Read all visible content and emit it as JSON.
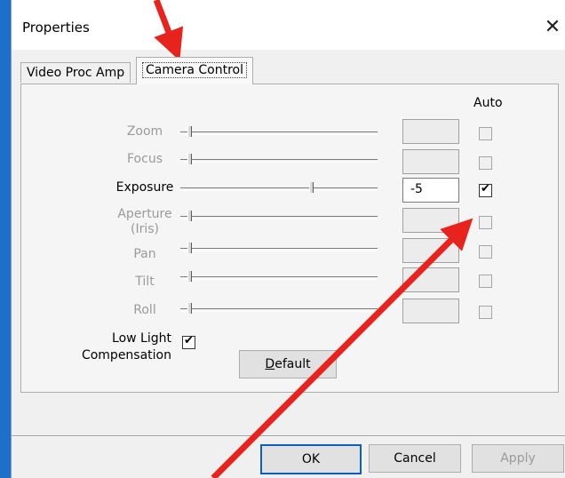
{
  "window": {
    "title": "Properties",
    "close_glyph": "✕"
  },
  "tabs": [
    {
      "label": "Video Proc Amp"
    },
    {
      "label": "Camera Control"
    }
  ],
  "auto_header": "Auto",
  "controls": [
    {
      "label": "Zoom",
      "value": "",
      "enabled": false,
      "slider_level": 0,
      "auto": false
    },
    {
      "label": "Focus",
      "value": "",
      "enabled": false,
      "slider_level": 0,
      "auto": false
    },
    {
      "label": "Exposure",
      "value": "-5",
      "enabled": true,
      "slider_level": 0.68,
      "auto": true
    },
    {
      "label": "Aperture",
      "sublabel": "(Iris)",
      "value": "",
      "enabled": false,
      "slider_level": 0,
      "auto": false
    },
    {
      "label": "Pan",
      "value": "",
      "enabled": false,
      "slider_level": 0,
      "auto": false
    },
    {
      "label": "Tilt",
      "value": "",
      "enabled": false,
      "slider_level": 0,
      "auto": false
    },
    {
      "label": "Roll",
      "value": "",
      "enabled": false,
      "slider_level": 0,
      "auto": false
    }
  ],
  "low_light": {
    "line1": "Low Light",
    "line2": "Compensation",
    "checked": true
  },
  "buttons": {
    "default_prefix": "",
    "default_underline": "D",
    "default_rest": "efault",
    "ok": "OK",
    "cancel": "Cancel",
    "apply": "Apply"
  },
  "check_glyph": "✔",
  "colors": {
    "annotation_arrow": "#e8221c",
    "window_bg": "#f0f0f0",
    "desktop": "#1d6fc9"
  }
}
